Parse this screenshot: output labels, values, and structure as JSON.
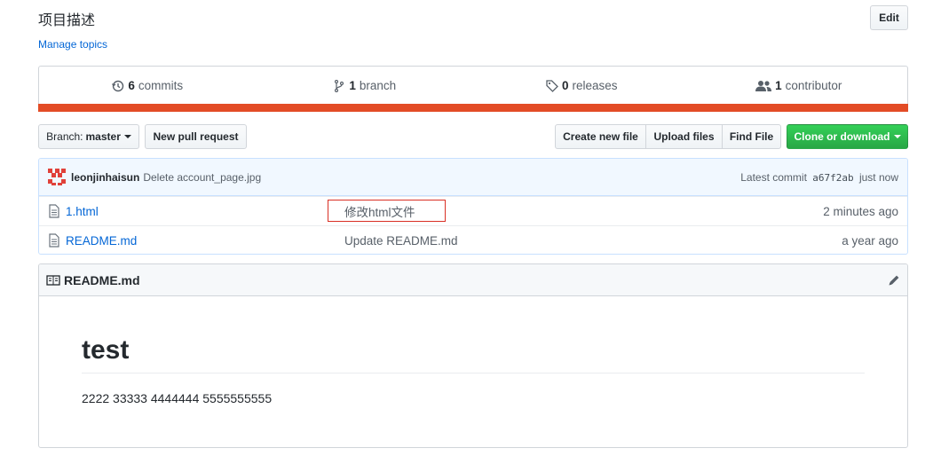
{
  "repo": {
    "description": "项目描述",
    "manage_topics": "Manage topics",
    "edit_label": "Edit"
  },
  "summary": {
    "commits": {
      "count": "6",
      "label": "commits",
      "icon": "history-icon"
    },
    "branches": {
      "count": "1",
      "label": "branch",
      "icon": "git-branch-icon"
    },
    "releases": {
      "count": "0",
      "label": "releases",
      "icon": "tag-icon"
    },
    "contributors": {
      "count": "1",
      "label": "contributor",
      "icon": "people-icon"
    },
    "language_bar_color": "#e34c26"
  },
  "toolbar": {
    "branch_prefix": "Branch:",
    "branch_value": "master",
    "new_pull_request": "New pull request",
    "create_new_file": "Create new file",
    "upload_files": "Upload files",
    "find_file": "Find File",
    "clone_or_download": "Clone or download",
    "clone_color": "#28a745"
  },
  "latest_commit": {
    "author": "leonjinhaisun",
    "message": "Delete account_page.jpg",
    "prefix": "Latest commit",
    "sha": "a67f2ab",
    "time": "just now"
  },
  "files": [
    {
      "name": "1.html",
      "message": "修改html文件",
      "time": "2 minutes ago",
      "icon": "file-icon"
    },
    {
      "name": "README.md",
      "message": "Update README.md",
      "time": "a year ago",
      "icon": "file-icon"
    }
  ],
  "annotation_color": "#d93025",
  "readme": {
    "filename": "README.md",
    "heading": "test",
    "paragraph": "2222 33333 4444444 5555555555"
  }
}
